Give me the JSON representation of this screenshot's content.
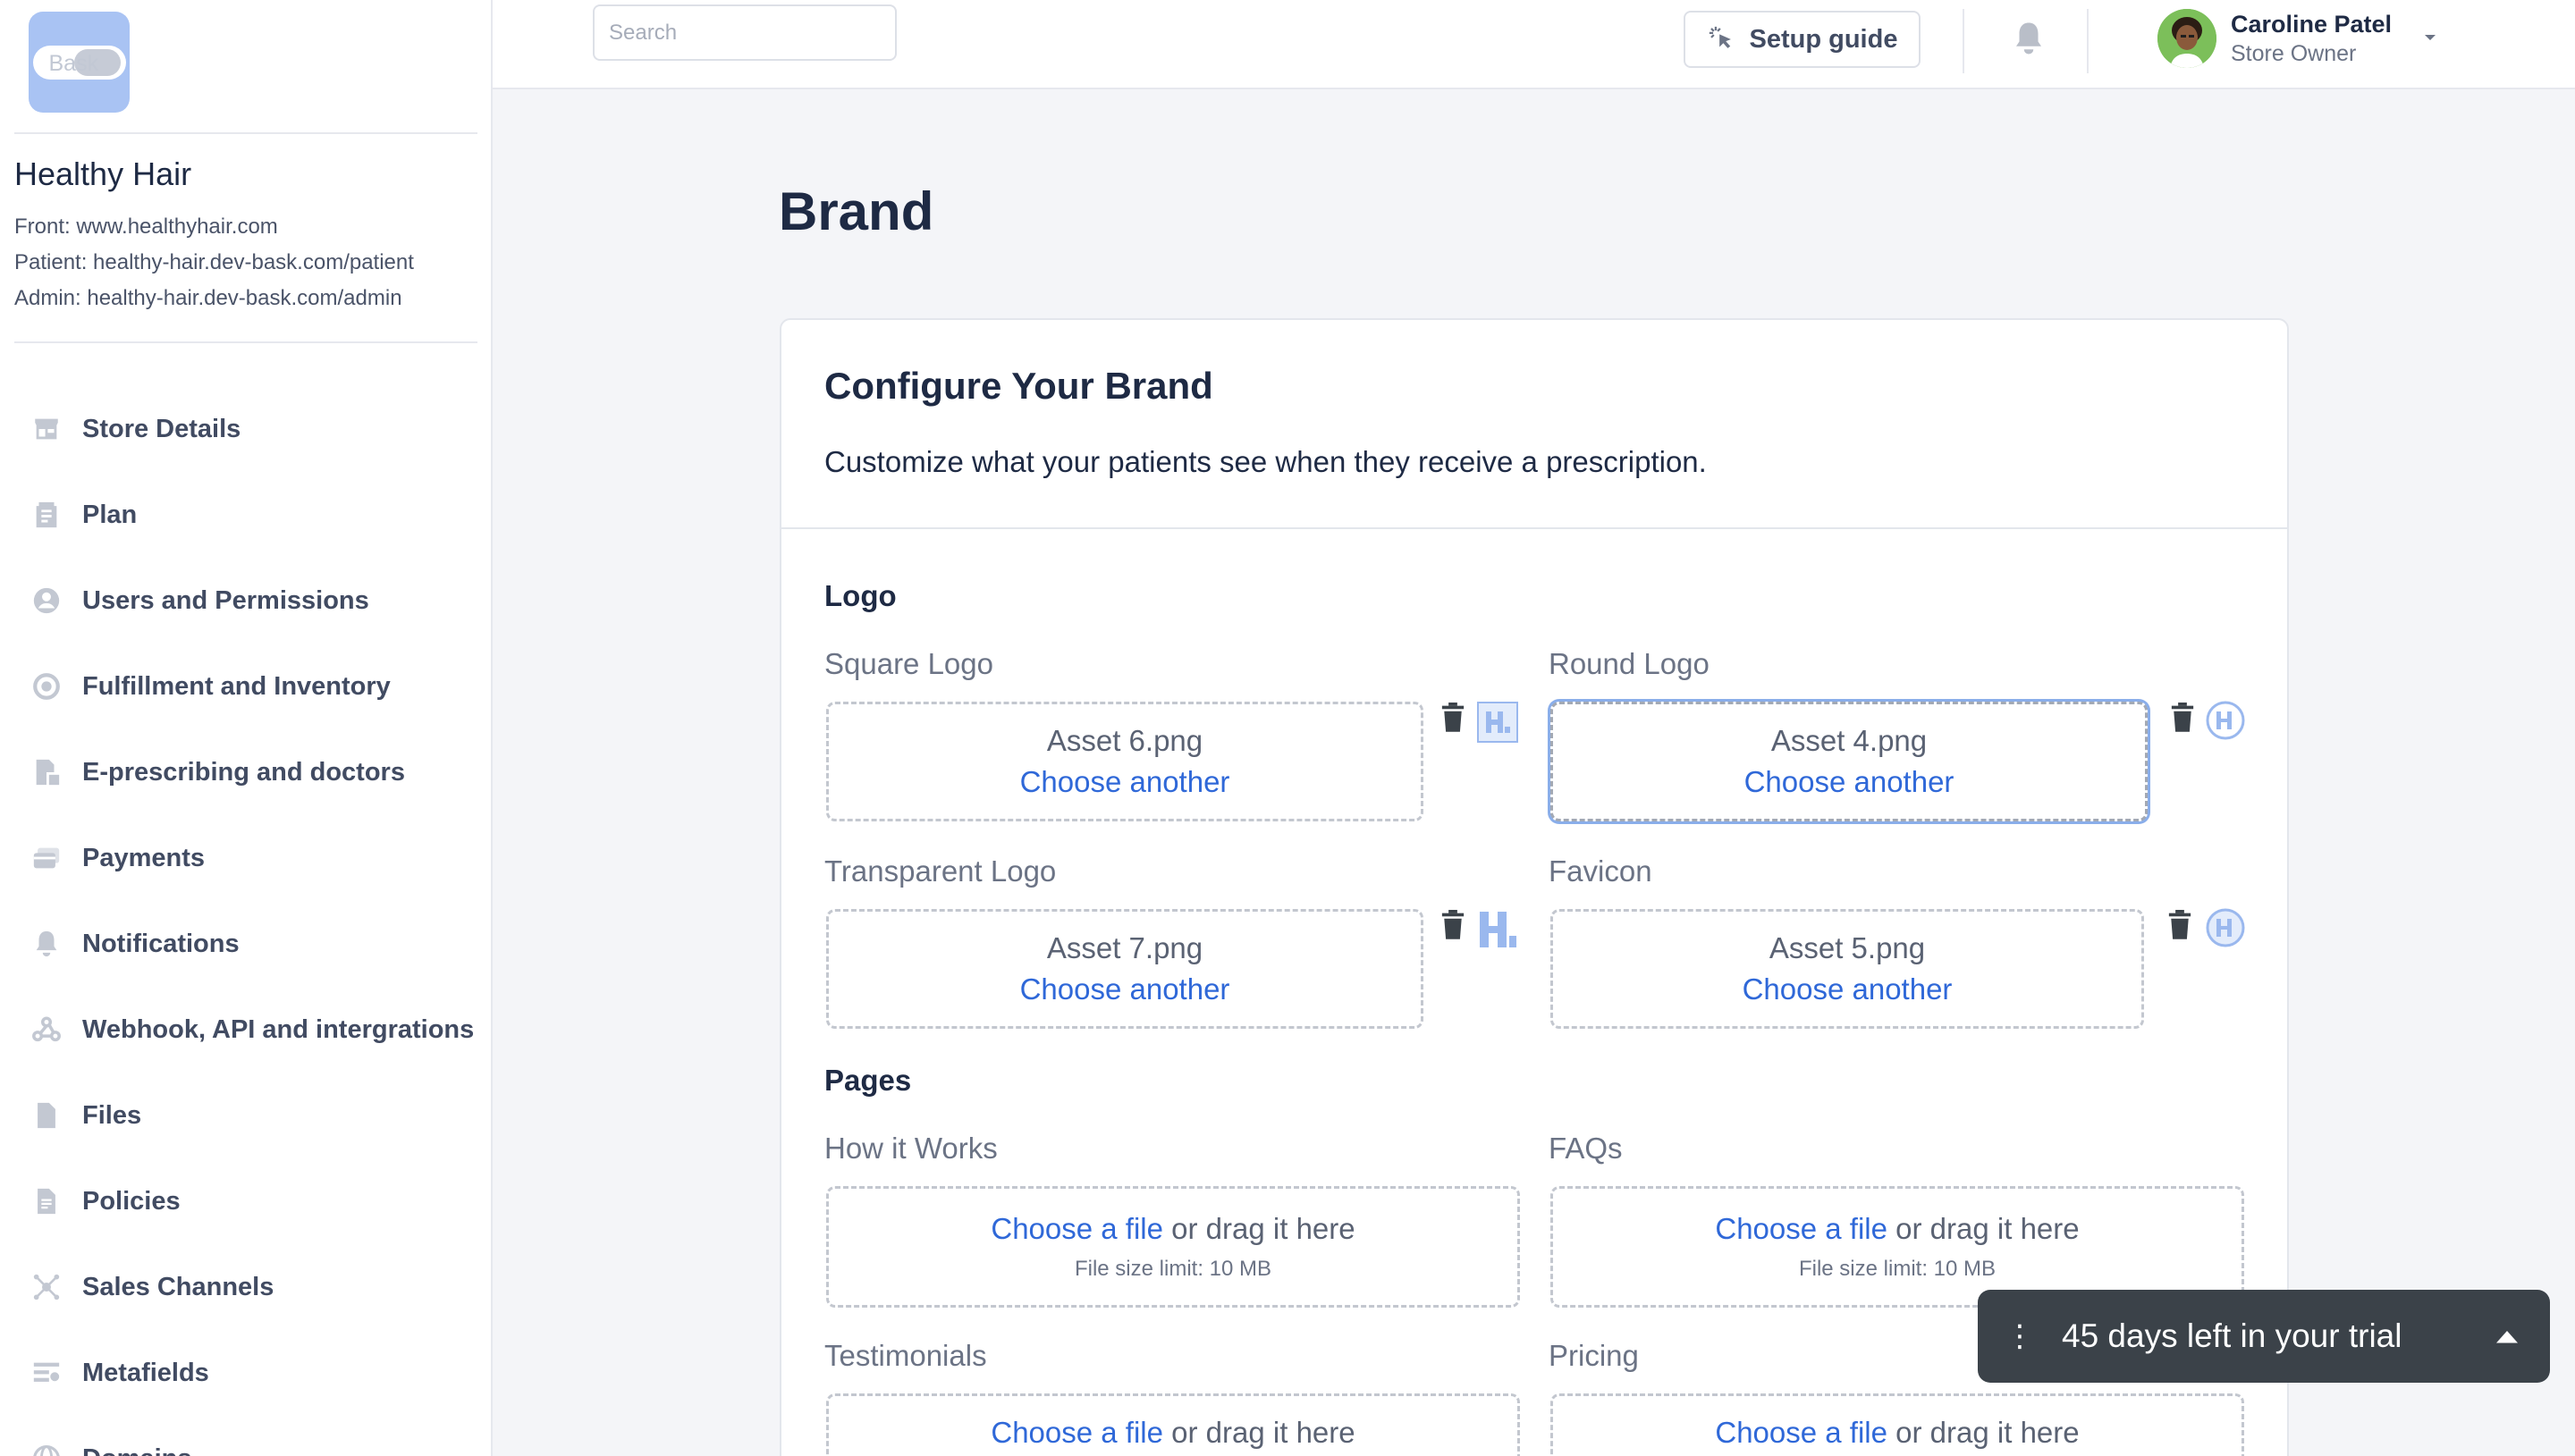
{
  "sidebar": {
    "logo_text": "Bask",
    "store_name": "Healthy Hair",
    "links": {
      "front": "Front: www.healthyhair.com",
      "patient": "Patient: healthy-hair.dev-bask.com/patient",
      "admin": "Admin: healthy-hair.dev-bask.com/admin"
    },
    "items": [
      {
        "label": "Store Details",
        "icon": "store-icon"
      },
      {
        "label": "Plan",
        "icon": "plan-icon"
      },
      {
        "label": "Users and Permissions",
        "icon": "user-circle-icon"
      },
      {
        "label": "Fulfillment and Inventory",
        "icon": "fulfillment-icon"
      },
      {
        "label": "E-prescribing and doctors",
        "icon": "prescription-icon"
      },
      {
        "label": "Payments",
        "icon": "payments-icon"
      },
      {
        "label": "Notifications",
        "icon": "bell-icon"
      },
      {
        "label": "Webhook, API and intergrations",
        "icon": "webhook-icon"
      },
      {
        "label": "Files",
        "icon": "file-icon"
      },
      {
        "label": "Policies",
        "icon": "policy-icon"
      },
      {
        "label": "Sales Channels",
        "icon": "channels-icon"
      },
      {
        "label": "Metafields",
        "icon": "metafields-icon"
      },
      {
        "label": "Domains",
        "icon": "globe-icon"
      }
    ]
  },
  "topbar": {
    "search_placeholder": "Search",
    "setup_guide": "Setup guide",
    "user": {
      "name": "Caroline Patel",
      "role": "Store Owner"
    }
  },
  "page": {
    "title": "Brand"
  },
  "card": {
    "title": "Configure Your Brand",
    "subtitle": "Customize what your patients see when they receive a prescription.",
    "logo_section": "Logo",
    "pages_section": "Pages",
    "logos": {
      "square": {
        "label": "Square Logo",
        "file": "Asset 6.png",
        "action": "Choose another"
      },
      "round": {
        "label": "Round Logo",
        "file": "Asset 4.png",
        "action": "Choose another"
      },
      "transparent": {
        "label": "Transparent Logo",
        "file": "Asset 7.png",
        "action": "Choose another"
      },
      "favicon": {
        "label": "Favicon",
        "file": "Asset 5.png",
        "action": "Choose another"
      }
    },
    "pages": {
      "how_it_works": {
        "label": "How it Works",
        "link": "Choose a file",
        "rest": " or drag it here",
        "limit": "File size limit: 10 MB"
      },
      "faqs": {
        "label": "FAQs",
        "link": "Choose a file",
        "rest": " or drag it here",
        "limit": "File size limit: 10 MB"
      },
      "testimonials": {
        "label": "Testimonials",
        "link": "Choose a file",
        "rest": " or drag it here"
      },
      "pricing": {
        "label": "Pricing",
        "link": "Choose a file",
        "rest": " or drag it here"
      }
    }
  },
  "toast": {
    "message": "45 days left in your trial"
  },
  "colors": {
    "accent": "#2f68d8",
    "logo_bg": "#a9c3f3",
    "toast_bg": "#3b4249"
  }
}
